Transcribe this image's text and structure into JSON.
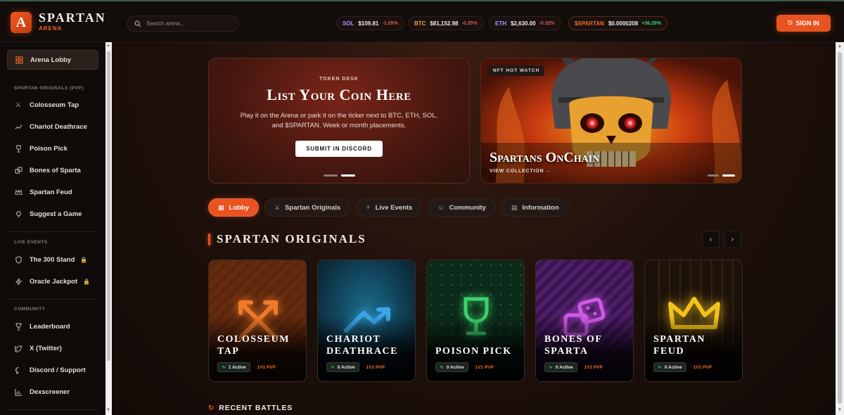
{
  "header": {
    "brand_name": "SPARTAN",
    "brand_sub": "ARENA",
    "logo_letter": "A",
    "search_placeholder": "Search arena...",
    "sign_in_label": "SIGN IN",
    "tickers": [
      {
        "symbol": "SOL",
        "price": "$109.81",
        "change": "-1.05%",
        "symbol_color": "#b58cff",
        "change_color": "#e0584a"
      },
      {
        "symbol": "BTC",
        "price": "$81,152.98",
        "change": "-0.35%",
        "symbol_color": "#f0a23a",
        "change_color": "#e0584a"
      },
      {
        "symbol": "ETH",
        "price": "$2,630.00",
        "change": "-0.32%",
        "symbol_color": "#8fa8ff",
        "change_color": "#e0584a"
      },
      {
        "symbol": "$SPARTAN",
        "price": "$0.0000208",
        "change": "+36.28%",
        "symbol_color": "#f06a2a",
        "change_color": "#3cd26a"
      }
    ]
  },
  "sidebar": {
    "lobby_label": "Arena Lobby",
    "originals_heading": "SPARTAN ORIGINALS (PVP)",
    "originals": [
      {
        "label": "Colosseum Tap",
        "icon": "crossed-swords-icon"
      },
      {
        "label": "Chariot Deathrace",
        "icon": "trend-up-icon"
      },
      {
        "label": "Poison Pick",
        "icon": "goblet-icon"
      },
      {
        "label": "Bones of Sparta",
        "icon": "dice-icon"
      },
      {
        "label": "Spartan Feud",
        "icon": "crown-icon"
      },
      {
        "label": "Suggest a Game",
        "icon": "bulb-icon"
      }
    ],
    "events_heading": "LIVE EVENTS",
    "events": [
      {
        "label": "The 300 Stand",
        "icon": "shield-icon"
      },
      {
        "label": "Oracle Jackpot",
        "icon": "lightning-icon"
      }
    ],
    "community_heading": "COMMUNITY",
    "community": [
      {
        "label": "Leaderboard",
        "icon": "trophy-icon"
      },
      {
        "label": "X (Twitter)",
        "icon": "twitter-icon"
      },
      {
        "label": "Discord / Support",
        "icon": "chat-icon"
      },
      {
        "label": "Dexscreener",
        "icon": "chart-icon"
      }
    ]
  },
  "hero": {
    "promo_eyebrow": "TOKEN DESK",
    "promo_title": "List Your Coin Here",
    "promo_text": "Play it on the Arena or park it on the ticker next to BTC, ETH, SOL, and $SPARTAN. Week or month placements.",
    "promo_button": "SUBMIT IN DISCORD",
    "nft_tag": "NFT HOT WATCH",
    "nft_title": "Spartans OnChain",
    "nft_link": "VIEW COLLECTION →"
  },
  "tabs": [
    {
      "label": "Lobby",
      "icon": "grid-icon"
    },
    {
      "label": "Spartan Originals",
      "icon": "crossed-swords-icon"
    },
    {
      "label": "Live Events",
      "icon": "lightning-icon"
    },
    {
      "label": "Community",
      "icon": "users-icon"
    },
    {
      "label": "Information",
      "icon": "document-icon"
    }
  ],
  "section_title": "SPARTAN ORIGINALS",
  "games": [
    {
      "name": "Colosseum Tap",
      "active": "1 Active",
      "mode": "1V1 PVP",
      "accent": "#f07a2a"
    },
    {
      "name": "Chariot Deathrace",
      "active": "0 Active",
      "mode": "1V1 PVP",
      "accent": "#3aa6e8"
    },
    {
      "name": "Poison Pick",
      "active": "0 Active",
      "mode": "1V1 PVP",
      "accent": "#3cd26a"
    },
    {
      "name": "Bones of Sparta",
      "active": "0 Active",
      "mode": "1V1 PVP",
      "accent": "#d05ae8"
    },
    {
      "name": "Spartan Feud",
      "active": "0 Active",
      "mode": "1V1 PVP",
      "accent": "#f2c21a"
    }
  ],
  "recent_title": "RECENT BATTLES",
  "colors": {
    "accent": "#e9531f"
  }
}
